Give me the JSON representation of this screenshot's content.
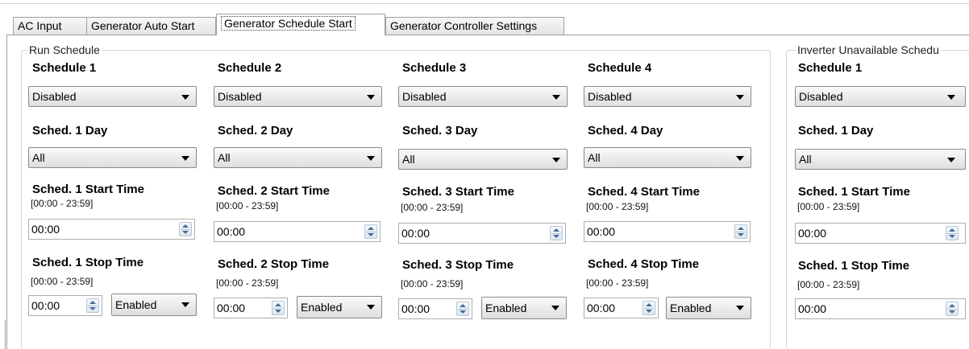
{
  "tabs": [
    {
      "label": "AC Input",
      "active": false
    },
    {
      "label": "Generator Auto Start",
      "active": false
    },
    {
      "label": "Generator Schedule Start",
      "active": true
    },
    {
      "label": "Generator Controller Settings",
      "active": false
    }
  ],
  "run_schedule": {
    "title": "Run Schedule",
    "columns": [
      {
        "schedule_label": "Schedule 1",
        "schedule_value": "Disabled",
        "day_label": "Sched. 1 Day",
        "day_value": "All",
        "start_label": "Sched. 1 Start Time",
        "start_range": "[00:00 - 23:59]",
        "start_value": "00:00",
        "stop_label": "Sched. 1 Stop Time",
        "stop_range": "[00:00 - 23:59]",
        "stop_value": "00:00",
        "stop_enable_value": "Enabled"
      },
      {
        "schedule_label": "Schedule 2",
        "schedule_value": "Disabled",
        "day_label": "Sched. 2 Day",
        "day_value": "All",
        "start_label": "Sched. 2 Start Time",
        "start_range": "[00:00 - 23:59]",
        "start_value": "00:00",
        "stop_label": "Sched. 2 Stop Time",
        "stop_range": "[00:00 - 23:59]",
        "stop_value": "00:00",
        "stop_enable_value": "Enabled"
      },
      {
        "schedule_label": "Schedule 3",
        "schedule_value": "Disabled",
        "day_label": "Sched. 3 Day",
        "day_value": "All",
        "start_label": "Sched. 3 Start Time",
        "start_range": "[00:00 - 23:59]",
        "start_value": "00:00",
        "stop_label": "Sched. 3 Stop Time",
        "stop_range": "[00:00 - 23:59]",
        "stop_value": "00:00",
        "stop_enable_value": "Enabled"
      },
      {
        "schedule_label": "Schedule 4",
        "schedule_value": "Disabled",
        "day_label": "Sched. 4 Day",
        "day_value": "All",
        "start_label": "Sched. 4 Start Time",
        "start_range": "[00:00 - 23:59]",
        "start_value": "00:00",
        "stop_label": "Sched. 4 Stop Time",
        "stop_range": "[00:00 - 23:59]",
        "stop_value": "00:00",
        "stop_enable_value": "Enabled"
      }
    ]
  },
  "inverter_schedule": {
    "title": "Inverter Unavailable Schedu",
    "schedule_label": "Schedule 1",
    "schedule_value": "Disabled",
    "day_label": "Sched. 1 Day",
    "day_value": "All",
    "start_label": "Sched. 1 Start Time",
    "start_range": "[00:00 - 23:59]",
    "start_value": "00:00",
    "stop_label": "Sched. 1 Stop Time",
    "stop_range": "[00:00 - 23:59]",
    "stop_value": "00:00"
  }
}
